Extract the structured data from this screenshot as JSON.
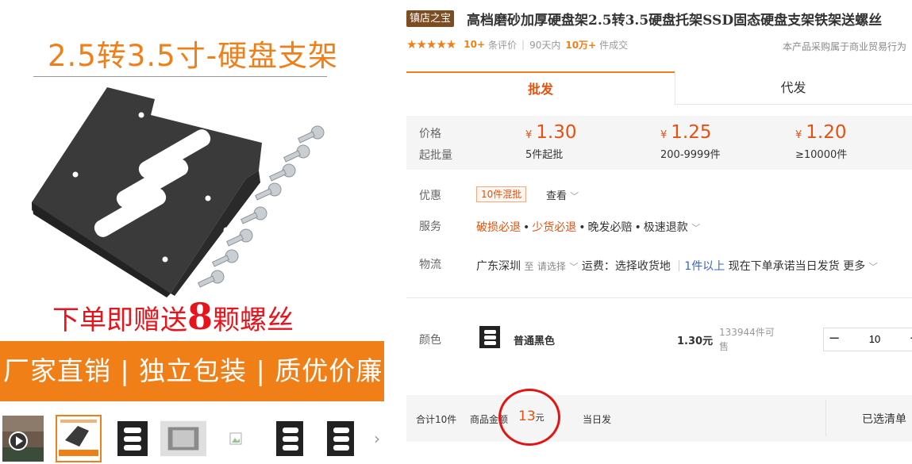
{
  "gallery": {
    "main_image": {
      "title": "2.5转3.5寸-硬盘支架",
      "gift_prefix": "下单即赠送",
      "gift_number": "8",
      "gift_suffix": "颗螺丝",
      "banner": "厂家直销 | 独立包装 | 质优价廉"
    },
    "thumbnails": [
      {
        "kind": "video"
      },
      {
        "kind": "image",
        "selected": true
      },
      {
        "kind": "image"
      },
      {
        "kind": "image"
      },
      {
        "kind": "broken-image"
      },
      {
        "kind": "image"
      },
      {
        "kind": "image"
      }
    ],
    "next_arrow": "›"
  },
  "product": {
    "shop_badge": "镇店之宝",
    "title": "高档磨砂加厚硬盘架2.5转3.5硬盘托架SSD固态硬盘支架铁架送螺丝",
    "stars": "★★★★★",
    "rating": 4.5,
    "review_count": "10+",
    "review_label": "条评价",
    "sales_period": "90天内",
    "sales_count": "10万+",
    "sales_label": "件成交",
    "trade_note": "本产品采购属于商业贸易行为"
  },
  "tabs": [
    {
      "label": "批发",
      "active": true
    },
    {
      "label": "代发",
      "active": false
    }
  ],
  "price_box": {
    "price_label": "价格",
    "moq_label": "起批量",
    "currency": "¥",
    "tiers": [
      {
        "price": "1.30",
        "qty": "5件起批"
      },
      {
        "price": "1.25",
        "qty": "200-9999件"
      },
      {
        "price": "1.20",
        "qty": "≥10000件"
      }
    ]
  },
  "promo": {
    "label": "优惠",
    "tag": "10件混批",
    "view": "查看"
  },
  "service": {
    "label": "服务",
    "items": [
      "破损必退",
      "少货必退",
      "晚发必赔",
      "极速退款"
    ]
  },
  "logistics": {
    "label": "物流",
    "origin": "广东深圳",
    "to": "至",
    "choose": "请选择",
    "freight": "运费：选择收货地",
    "min_qty": "1件以上",
    "dispatch": "现在下单承诺当日发货",
    "more": "更多"
  },
  "sku": {
    "label": "颜色",
    "name": "普通黑色",
    "price": "1.30元",
    "stock": "133944件可售",
    "quantity": "10",
    "minus": "−",
    "plus": "+"
  },
  "summary": {
    "total_qty": "合计10件",
    "amount_label": "商品金额",
    "amount": "13",
    "amount_unit": "元",
    "delivery": "当日发",
    "selected_list": "已选清单"
  },
  "colors": {
    "accent_orange": "#f07f18",
    "price_red": "#e8500f",
    "shop_badge_brown": "#7d4d22",
    "annotation_red": "#e21414"
  }
}
